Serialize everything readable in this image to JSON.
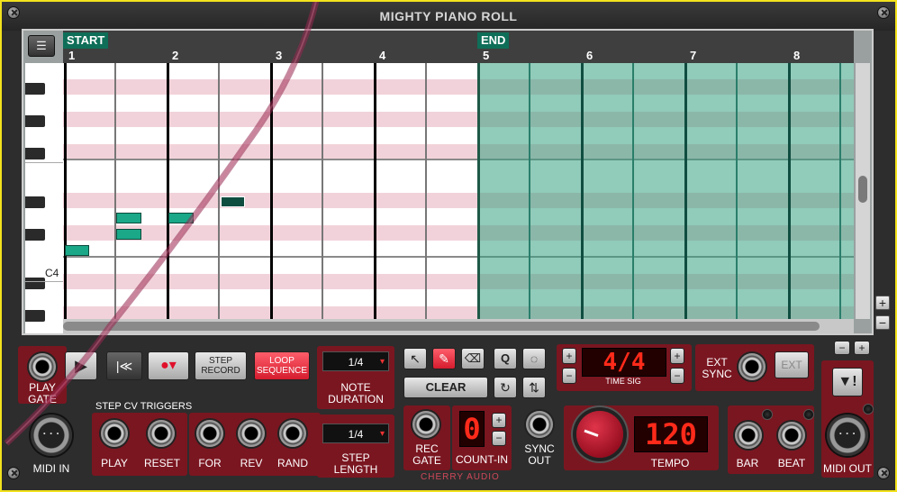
{
  "title": "MIGHTY PIANO ROLL",
  "brand": "CHERRY AUDIO",
  "roll": {
    "start_label": "START",
    "end_label": "END",
    "bars": [
      "1",
      "2",
      "3",
      "4",
      "5",
      "6",
      "7",
      "8"
    ],
    "c4_label": "C4",
    "menu_icon": "menu-icon"
  },
  "zoom": {
    "plus": "+",
    "minus": "−"
  },
  "labels": {
    "play_gate": "PLAY\nGATE",
    "midi_in": "MIDI IN",
    "midi_out": "MIDI OUT",
    "step_cv_triggers": "STEP CV TRIGGERS",
    "play": "PLAY",
    "reset": "RESET",
    "for": "FOR",
    "rev": "REV",
    "rand": "RAND",
    "note_duration": "NOTE\nDURATION",
    "step_length": "STEP\nLENGTH",
    "rec_gate": "REC\nGATE",
    "count_in": "COUNT-IN",
    "sync_out": "SYNC\nOUT",
    "tempo": "TEMPO",
    "time_sig": "TIME SIG",
    "ext_sync": "EXT\nSYNC",
    "bar": "BAR",
    "beat": "BEAT"
  },
  "buttons": {
    "step_record": "STEP\nRECORD",
    "loop_sequence": "LOOP\nSEQUENCE",
    "clear": "CLEAR",
    "ext": "EXT"
  },
  "values": {
    "note_duration": "1/4",
    "step_length": "1/4",
    "time_sig": "4/4",
    "count_in": "0",
    "tempo": "120"
  },
  "colors": {
    "panel": "#7a1620",
    "note": "#1aa888",
    "grid_pink": "#f2d2da",
    "loop_teal": "#37a082"
  }
}
